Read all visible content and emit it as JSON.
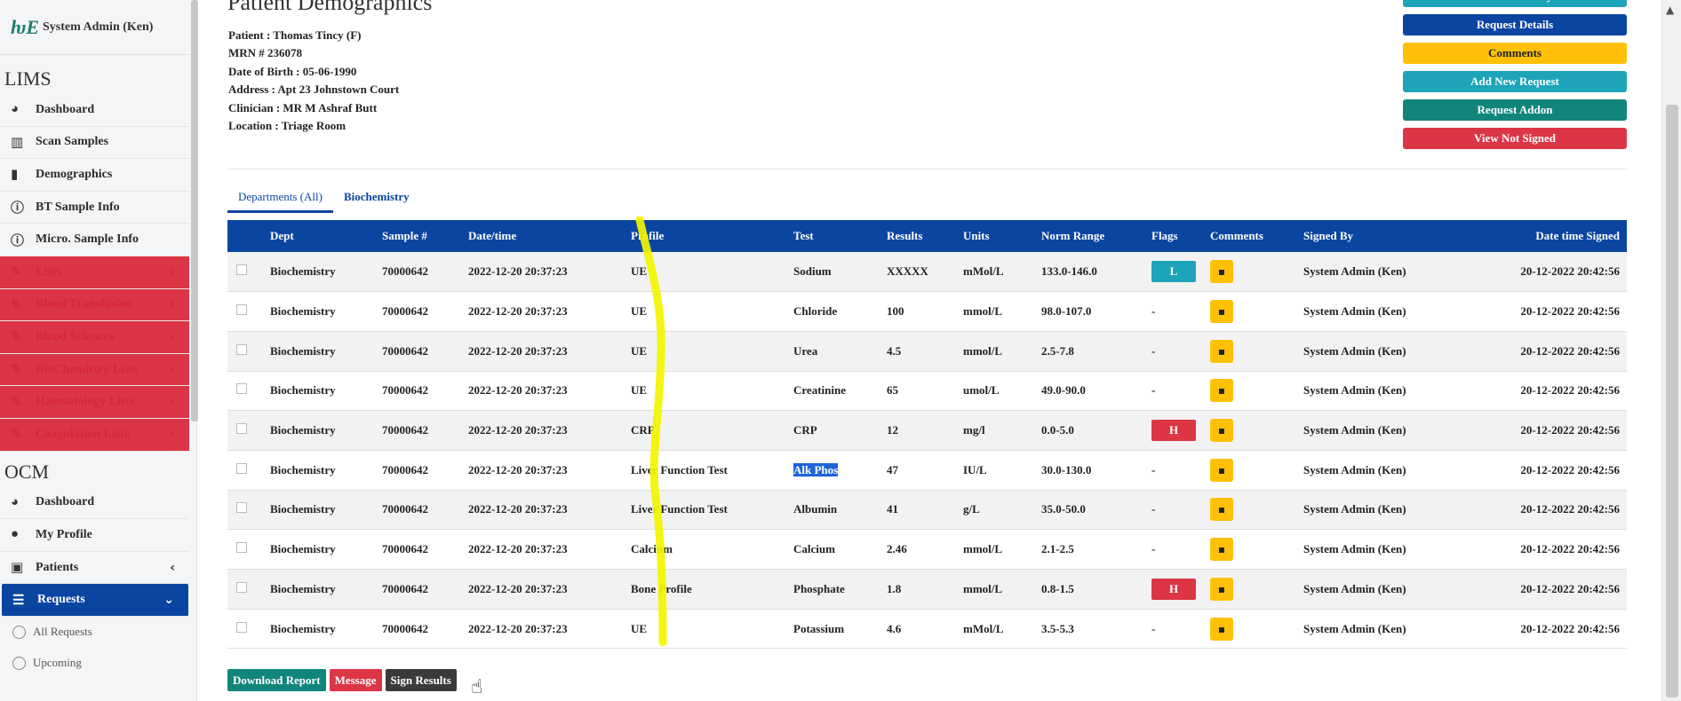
{
  "sidebar": {
    "brand_logo": "ƕE",
    "user_name": "System Admin (Ken)",
    "lims_title": "LIMS",
    "lims_items": [
      {
        "label": "Dashboard",
        "icon": "tachometer-icon"
      },
      {
        "label": "Scan Samples",
        "icon": "barcode-icon"
      },
      {
        "label": "Demographics",
        "icon": "file-icon"
      },
      {
        "label": "BT Sample Info",
        "icon": "info-circle-icon"
      },
      {
        "label": "Micro. Sample Info",
        "icon": "info-circle-icon"
      },
      {
        "label": "Lists",
        "icon": "pencil-icon"
      },
      {
        "label": "Blood Transfusion",
        "icon": "pencil-icon"
      },
      {
        "label": "Blood Sciences",
        "icon": "pencil-icon"
      },
      {
        "label": "BioChemistry Lists",
        "icon": "pencil-icon"
      },
      {
        "label": "Haematology Lists",
        "icon": "pencil-icon"
      },
      {
        "label": "Coagulation Lists",
        "icon": "pencil-icon"
      }
    ],
    "ocm_title": "OCM",
    "ocm_items": [
      {
        "label": "Dashboard",
        "icon": "tachometer-icon"
      },
      {
        "label": "My Profile",
        "icon": "user-icon"
      },
      {
        "label": "Patients",
        "icon": "hospital-user-icon"
      },
      {
        "label": "Requests",
        "icon": "list-icon"
      }
    ],
    "sub_items": [
      "All Requests",
      "Upcoming"
    ]
  },
  "header": {
    "title": "Patient Demographics",
    "patient_line": "Patient : Thomas Tincy (F)",
    "mrn_line": "MRN # 236078",
    "dob_line": "Date of Birth : 05-06-1990",
    "address_line": "Address : Apt 23 Johnstown Court",
    "clinician_line": "Clinician : MR M Ashraf Butt",
    "location_line": "Location : Triage Room"
  },
  "actions": {
    "patient_history": "Patient History",
    "request_details": "Request Details",
    "comments": "Comments",
    "add_new_request": "Add New Request",
    "request_addon": "Request Addon",
    "view_not_signed": "View Not Signed"
  },
  "tabs": [
    "Departments (All)",
    "Biochemistry"
  ],
  "table": {
    "headers": [
      "Dept",
      "Sample #",
      "Date/time",
      "Profile",
      "Test",
      "Results",
      "Units",
      "Norm Range",
      "Flags",
      "Comments",
      "Signed By",
      "Date time Signed"
    ],
    "rows": [
      [
        "Biochemistry",
        "70000642",
        "2022-12-20 20:37:23",
        "UE",
        "Sodium",
        "XXXXX",
        "mMol/L",
        "133.0-146.0",
        "L",
        "System Admin (Ken)",
        "20-12-2022 20:42:56"
      ],
      [
        "Biochemistry",
        "70000642",
        "2022-12-20 20:37:23",
        "UE",
        "Chloride",
        "100",
        "mmol/L",
        "98.0-107.0",
        "-",
        "System Admin (Ken)",
        "20-12-2022 20:42:56"
      ],
      [
        "Biochemistry",
        "70000642",
        "2022-12-20 20:37:23",
        "UE",
        "Urea",
        "4.5",
        "mmol/L",
        "2.5-7.8",
        "-",
        "System Admin (Ken)",
        "20-12-2022 20:42:56"
      ],
      [
        "Biochemistry",
        "70000642",
        "2022-12-20 20:37:23",
        "UE",
        "Creatinine",
        "65",
        "umol/L",
        "49.0-90.0",
        "-",
        "System Admin (Ken)",
        "20-12-2022 20:42:56"
      ],
      [
        "Biochemistry",
        "70000642",
        "2022-12-20 20:37:23",
        "CRP",
        "CRP",
        "12",
        "mg/l",
        "0.0-5.0",
        "H",
        "System Admin (Ken)",
        "20-12-2022 20:42:56"
      ],
      [
        "Biochemistry",
        "70000642",
        "2022-12-20 20:37:23",
        "Liver Function Test",
        "Alk Phos",
        "47",
        "IU/L",
        "30.0-130.0",
        "-",
        "System Admin (Ken)",
        "20-12-2022 20:42:56"
      ],
      [
        "Biochemistry",
        "70000642",
        "2022-12-20 20:37:23",
        "Liver Function Test",
        "Albumin",
        "41",
        "g/L",
        "35.0-50.0",
        "-",
        "System Admin (Ken)",
        "20-12-2022 20:42:56"
      ],
      [
        "Biochemistry",
        "70000642",
        "2022-12-20 20:37:23",
        "Calcium",
        "Calcium",
        "2.46",
        "mmol/L",
        "2.1-2.5",
        "-",
        "System Admin (Ken)",
        "20-12-2022 20:42:56"
      ],
      [
        "Biochemistry",
        "70000642",
        "2022-12-20 20:37:23",
        "Bone Profile",
        "Phosphate",
        "1.8",
        "mmol/L",
        "0.8-1.5",
        "H",
        "System Admin (Ken)",
        "20-12-2022 20:42:56"
      ],
      [
        "Biochemistry",
        "70000642",
        "2022-12-20 20:37:23",
        "UE",
        "Potassium",
        "4.6",
        "mMol/L",
        "3.5-5.3",
        "-",
        "System Admin (Ken)",
        "20-12-2022 20:42:56"
      ]
    ],
    "selected_test": "Alk Phos"
  },
  "bottom": {
    "download_report": "Download Report",
    "message": "Message",
    "sign_results": "Sign Results"
  },
  "colors": {
    "navy": "#0b45a2",
    "teal": "#1ea4b8",
    "yellow": "#ffc107",
    "green": "#10867a",
    "red": "#dc3545",
    "highlighter": "#f4f400"
  }
}
